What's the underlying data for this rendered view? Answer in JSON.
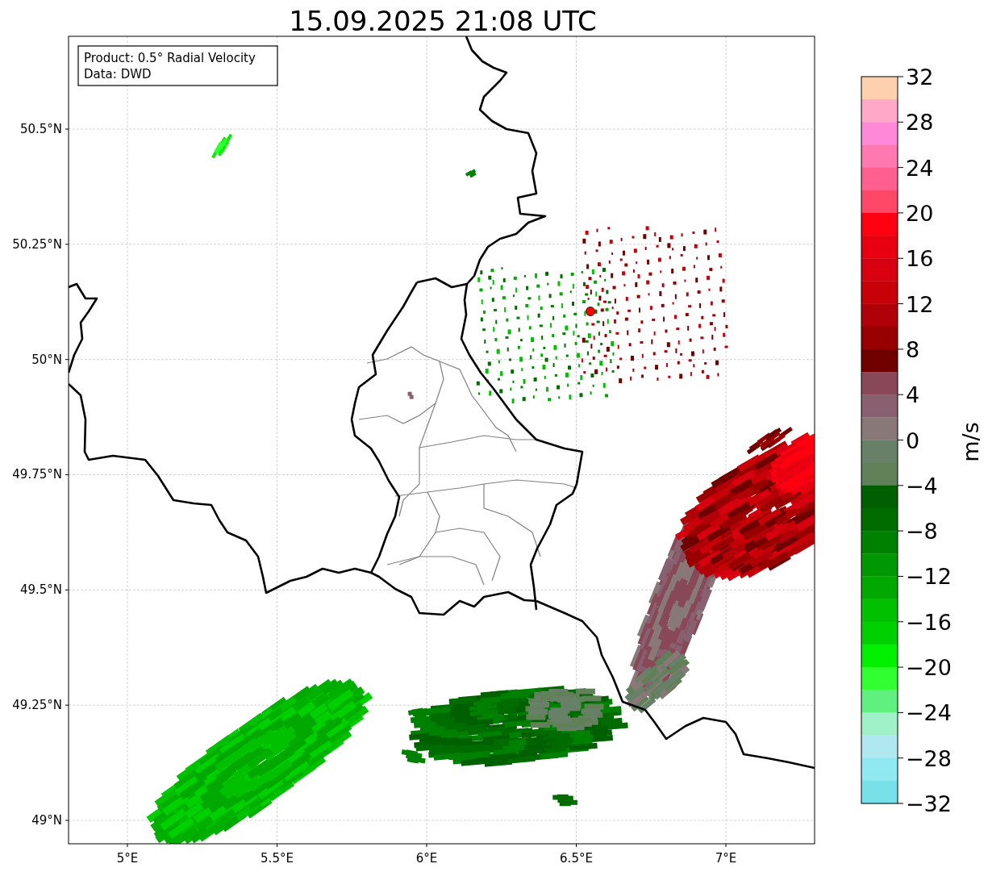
{
  "title": "15.09.2025 21:08 UTC",
  "map": {
    "legend": [
      "Product: 0.5° Radial Velocity",
      "Data: DWD"
    ],
    "y_tick_labels": [
      "50.5°N",
      "50.25°N",
      "50°N",
      "49.75°N",
      "49.5°N",
      "49.25°N",
      "49°N"
    ],
    "x_tick_labels": [
      "5°E",
      "5.5°E",
      "6°E",
      "6.5°E",
      "7°E"
    ]
  },
  "colorbar": {
    "label": "m/s",
    "tick_labels": [
      "32",
      "28",
      "24",
      "20",
      "16",
      "12",
      "8",
      "4",
      "0",
      "−4",
      "−8",
      "−12",
      "−16",
      "−20",
      "−24",
      "−28",
      "−32"
    ],
    "bins": [
      {
        "color": "#ffd0b0"
      },
      {
        "color": "#ffa8c8"
      },
      {
        "color": "#ff88d8"
      },
      {
        "color": "#ff78b0"
      },
      {
        "color": "#ff6090"
      },
      {
        "color": "#ff4868"
      },
      {
        "color": "#ff0010"
      },
      {
        "color": "#e80010"
      },
      {
        "color": "#d80010"
      },
      {
        "color": "#c80008"
      },
      {
        "color": "#b00008"
      },
      {
        "color": "#980000"
      },
      {
        "color": "#700000"
      },
      {
        "color": "#884858"
      },
      {
        "color": "#886070"
      },
      {
        "color": "#887878"
      },
      {
        "color": "#688068"
      },
      {
        "color": "#608058"
      },
      {
        "color": "#006000"
      },
      {
        "color": "#006c00"
      },
      {
        "color": "#008000"
      },
      {
        "color": "#009800"
      },
      {
        "color": "#00a800"
      },
      {
        "color": "#00c000"
      },
      {
        "color": "#00d000"
      },
      {
        "color": "#00f000"
      },
      {
        "color": "#30ff30"
      },
      {
        "color": "#60f080"
      },
      {
        "color": "#a0f0c8"
      },
      {
        "color": "#b0e8f0"
      },
      {
        "color": "#90e8f0"
      },
      {
        "color": "#78e0e8"
      }
    ]
  }
}
